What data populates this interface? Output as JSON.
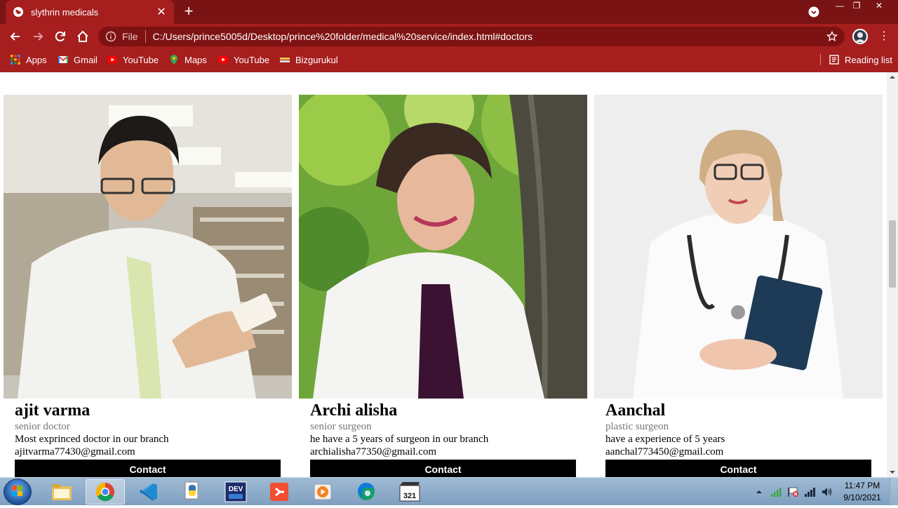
{
  "browser": {
    "tab_title": "slythrin medicals",
    "address_file_label": "File",
    "url": "C:/Users/prince5005d/Desktop/prince%20folder/medical%20service/index.html#doctors",
    "bookmarks": [
      {
        "label": "Apps",
        "icon": "apps-grid-icon"
      },
      {
        "label": "Gmail",
        "icon": "gmail-icon"
      },
      {
        "label": "YouTube",
        "icon": "youtube-icon"
      },
      {
        "label": "Maps",
        "icon": "maps-icon"
      },
      {
        "label": "YouTube",
        "icon": "youtube-icon"
      },
      {
        "label": "Bizgurukul",
        "icon": "bizgurukul-icon"
      }
    ],
    "reading_list_label": "Reading list",
    "colors": {
      "tabbar": "#7a1414",
      "toolbar": "#a61e1e"
    }
  },
  "doctors": [
    {
      "name": "ajit varma",
      "title": "senior doctor",
      "description": "Most exprinced doctor in our branch",
      "email": "ajitvarma77430@gmail.com",
      "button": "Contact"
    },
    {
      "name": "Archi alisha",
      "title": "senior surgeon",
      "description": "he have a 5 years of surgeon in our branch",
      "email": "archialisha77350@gmail.com",
      "button": "Contact"
    },
    {
      "name": "Aanchal",
      "title": "plastic surgeon",
      "description": "have a experience of 5 years",
      "email": "aanchal773450@gmail.com",
      "button": "Contact"
    }
  ],
  "taskbar": {
    "apps": [
      "file-explorer-icon",
      "chrome-icon",
      "vscode-icon",
      "python-icon",
      "devcpp-icon",
      "git-icon",
      "media-player-icon",
      "edge-icon",
      "media-player-classic-icon"
    ],
    "clock_time": "11:47 PM",
    "clock_date": "9/10/2021"
  }
}
